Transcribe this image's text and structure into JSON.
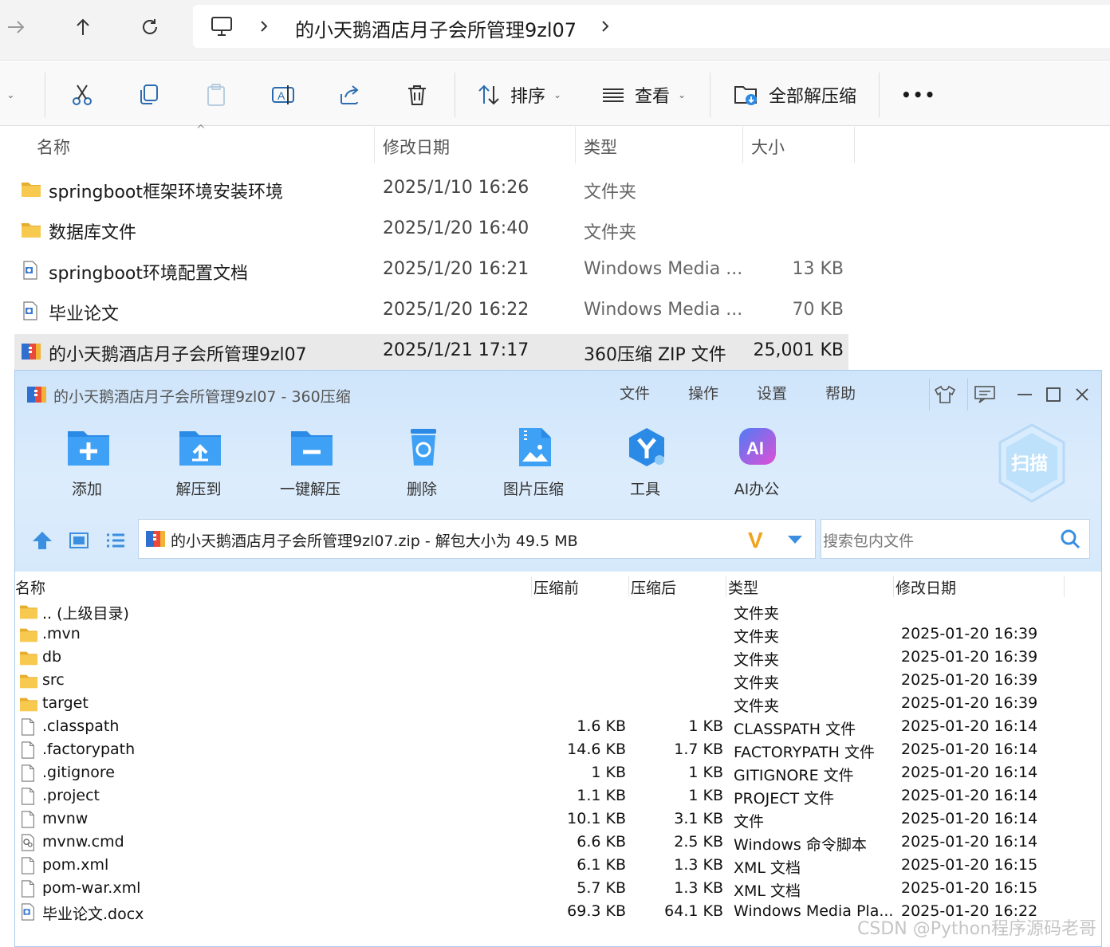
{
  "explorer": {
    "breadcrumb": "的小天鹅酒店月子会所管理9zl07",
    "toolbar": {
      "sort_label": "排序",
      "view_label": "查看",
      "extract_all_label": "全部解压缩",
      "more_label": "•••"
    },
    "columns": {
      "name": "名称",
      "date": "修改日期",
      "type": "类型",
      "size": "大小"
    },
    "rows": [
      {
        "name": "springboot框架环境安装环境",
        "date": "2025/1/10 16:26",
        "type": "文件夹",
        "size": "",
        "icon": "folder-icon"
      },
      {
        "name": "数据库文件",
        "date": "2025/1/20 16:40",
        "type": "文件夹",
        "size": "",
        "icon": "folder-icon"
      },
      {
        "name": "springboot环境配置文档",
        "date": "2025/1/20 16:21",
        "type": "Windows Media ...",
        "size": "13 KB",
        "icon": "document-icon"
      },
      {
        "name": "毕业论文",
        "date": "2025/1/20 16:22",
        "type": "Windows Media ...",
        "size": "70 KB",
        "icon": "document-icon"
      },
      {
        "name": "的小天鹅酒店月子会所管理9zl07",
        "date": "2025/1/21 17:17",
        "type": "360压缩 ZIP 文件",
        "size": "25,001 KB",
        "icon": "zip-archive-icon"
      }
    ]
  },
  "zipwin": {
    "title": "的小天鹅酒店月子会所管理9zl07 - 360压缩",
    "menu": [
      "文件",
      "操作",
      "设置",
      "帮助"
    ],
    "buttons": [
      {
        "label": "添加",
        "icon": "add-icon"
      },
      {
        "label": "解压到",
        "icon": "extract-to-icon"
      },
      {
        "label": "一键解压",
        "icon": "one-click-extract-icon"
      },
      {
        "label": "删除",
        "icon": "delete-icon"
      },
      {
        "label": "图片压缩",
        "icon": "image-compress-icon"
      },
      {
        "label": "工具",
        "icon": "tools-icon"
      },
      {
        "label": "AI办公",
        "icon": "ai-office-icon"
      }
    ],
    "scan_label": "扫描",
    "path_text": "的小天鹅酒店月子会所管理9zl07.zip - 解包大小为 49.5 MB",
    "search_placeholder": "搜索包内文件",
    "columns": {
      "name": "名称",
      "before": "压缩前",
      "after": "压缩后",
      "type": "类型",
      "date": "修改日期"
    },
    "rows": [
      {
        "name": ".. (上级目录)",
        "before": "",
        "after": "",
        "type": "文件夹",
        "date": "",
        "icon": "folder-icon"
      },
      {
        "name": ".mvn",
        "before": "",
        "after": "",
        "type": "文件夹",
        "date": "2025-01-20 16:39",
        "icon": "folder-icon"
      },
      {
        "name": "db",
        "before": "",
        "after": "",
        "type": "文件夹",
        "date": "2025-01-20 16:39",
        "icon": "folder-icon"
      },
      {
        "name": "src",
        "before": "",
        "after": "",
        "type": "文件夹",
        "date": "2025-01-20 16:39",
        "icon": "folder-icon"
      },
      {
        "name": "target",
        "before": "",
        "after": "",
        "type": "文件夹",
        "date": "2025-01-20 16:39",
        "icon": "folder-icon"
      },
      {
        "name": ".classpath",
        "before": "1.6 KB",
        "after": "1 KB",
        "type": "CLASSPATH 文件",
        "date": "2025-01-20 16:14",
        "icon": "file-icon"
      },
      {
        "name": ".factorypath",
        "before": "14.6 KB",
        "after": "1.7 KB",
        "type": "FACTORYPATH 文件",
        "date": "2025-01-20 16:14",
        "icon": "file-icon"
      },
      {
        "name": ".gitignore",
        "before": "1 KB",
        "after": "1 KB",
        "type": "GITIGNORE 文件",
        "date": "2025-01-20 16:14",
        "icon": "file-icon"
      },
      {
        "name": ".project",
        "before": "1.1 KB",
        "after": "1 KB",
        "type": "PROJECT 文件",
        "date": "2025-01-20 16:14",
        "icon": "file-icon"
      },
      {
        "name": "mvnw",
        "before": "10.1 KB",
        "after": "3.1 KB",
        "type": "文件",
        "date": "2025-01-20 16:14",
        "icon": "file-icon"
      },
      {
        "name": "mvnw.cmd",
        "before": "6.6 KB",
        "after": "2.5 KB",
        "type": "Windows 命令脚本",
        "date": "2025-01-20 16:14",
        "icon": "script-icon"
      },
      {
        "name": "pom.xml",
        "before": "6.1 KB",
        "after": "1.3 KB",
        "type": "XML 文档",
        "date": "2025-01-20 16:15",
        "icon": "file-icon"
      },
      {
        "name": "pom-war.xml",
        "before": "5.7 KB",
        "after": "1.3 KB",
        "type": "XML 文档",
        "date": "2025-01-20 16:15",
        "icon": "file-icon"
      },
      {
        "name": "毕业论文.docx",
        "before": "69.3 KB",
        "after": "64.1 KB",
        "type": "Windows Media Pla...",
        "date": "2025-01-20 16:22",
        "icon": "document-icon"
      }
    ]
  },
  "watermark": "CSDN @Python程序源码老哥",
  "colors": {
    "accent": "#2b8ae6",
    "zip_header": "#d6e9fb",
    "folder": "#f7c54a"
  }
}
